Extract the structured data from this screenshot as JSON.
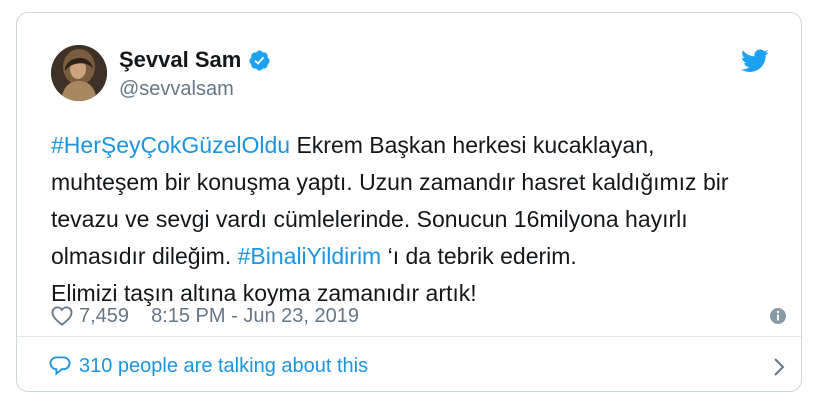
{
  "author": {
    "display_name": "Şevval Sam",
    "handle": "@sevvalsam",
    "verified_icon": "verified-badge-icon",
    "avatar_icon": "avatar"
  },
  "brand": {
    "icon": "twitter-bird-icon",
    "color": "#1da1f2"
  },
  "tweet": {
    "lines": [
      [
        {
          "text": "#HerŞeyÇokGüzelOldu",
          "type": "hashtag"
        },
        {
          "text": " Ekrem Başkan herkesi kucaklayan,",
          "type": "text"
        }
      ],
      [
        {
          "text": "muhteşem bir konuşma yaptı. Uzun zamandır hasret kaldığımız bir",
          "type": "text"
        }
      ],
      [
        {
          "text": "tevazu ve sevgi vardı cümlelerinde. Sonucun 16milyona hayırlı",
          "type": "text"
        }
      ],
      [
        {
          "text": "olmasıdır dileğim. ",
          "type": "text"
        },
        {
          "text": "#BinaliYildirim",
          "type": "hashtag"
        },
        {
          "text": " ‘ı da tebrik ederim.",
          "type": "text"
        }
      ],
      [
        {
          "text": "Elimizi taşın altına koyma zamanıdır artık!",
          "type": "text"
        }
      ]
    ]
  },
  "meta": {
    "likes": "7,459",
    "timestamp": "8:15 PM - Jun 23, 2019",
    "heart_icon": "heart-icon",
    "info_icon": "info-icon"
  },
  "footer": {
    "talking_label": "310 people are talking about this",
    "bubble_icon": "speech-bubble-icon",
    "chevron_icon": "chevron-right-icon"
  },
  "colors": {
    "link": "#1b95e0",
    "text": "#14171a",
    "secondary": "#657786",
    "border": "#ccd6dd"
  }
}
